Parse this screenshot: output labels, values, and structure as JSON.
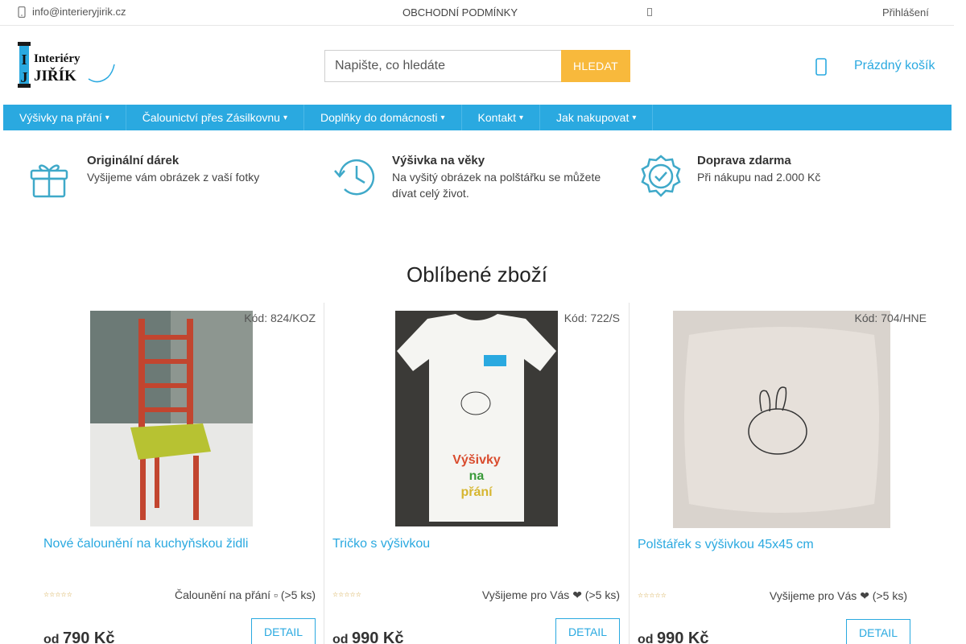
{
  "topbar": {
    "email": "info@interieryjirik.cz",
    "terms": "OBCHODNÍ PODMÍNKY",
    "login": "Přihlášení"
  },
  "logo": {
    "line1": "Interiéry",
    "line2": "JIŘÍK",
    "letter_i": "I",
    "letter_j": "J"
  },
  "search": {
    "placeholder": "Napište, co hledáte",
    "button": "HLEDAT"
  },
  "cart": {
    "label": "Prázdný košík",
    "icon": "cart-icon"
  },
  "nav": [
    {
      "label": "Výšivky na přání"
    },
    {
      "label": "Čalounictví přes Zásilkovnu"
    },
    {
      "label": "Doplňky do domácnosti"
    },
    {
      "label": "Kontakt"
    },
    {
      "label": "Jak nakupovat"
    }
  ],
  "benefits": [
    {
      "icon": "gift-icon",
      "title": "Originální dárek",
      "text": "Vyšijeme vám obrázek z vaší fotky"
    },
    {
      "icon": "clock-history-icon",
      "title": "Výšivka na věky",
      "text": "Na vyšitý obrázek na polštářku se můžete dívat celý život."
    },
    {
      "icon": "badge-check-icon",
      "title": "Doprava zdarma",
      "text": "Při nákupu nad 2.000 Kč"
    }
  ],
  "section_title": "Oblíbené zboží",
  "products": [
    {
      "code": "Kód: 824/KOZ",
      "name": "Nové čalounění na kuchyňskou židli",
      "availability": "Čalounění na přání ▫ (>5 ks)",
      "price_prefix": "od",
      "price": "790 Kč",
      "detail": "DETAIL",
      "stars": "☆☆☆☆☆"
    },
    {
      "code": "Kód: 722/S",
      "name": "Tričko s výšivkou",
      "availability": "Vyšijeme pro Vás ❤ (>5 ks)",
      "price_prefix": "od",
      "price": "990 Kč",
      "detail": "DETAIL",
      "stars": "☆☆☆☆☆",
      "image_text": [
        "Výšivky",
        "na",
        "přání"
      ]
    },
    {
      "code": "Kód: 704/HNE",
      "name": "Polštářek s výšivkou 45x45 cm",
      "availability": "Vyšijeme pro Vás ❤ (>5 ks)",
      "price_prefix": "od",
      "price": "990 Kč",
      "detail": "DETAIL",
      "stars": "☆☆☆☆☆"
    }
  ],
  "colors": {
    "accent": "#2aa9e0",
    "button_orange": "#f8b93c"
  }
}
